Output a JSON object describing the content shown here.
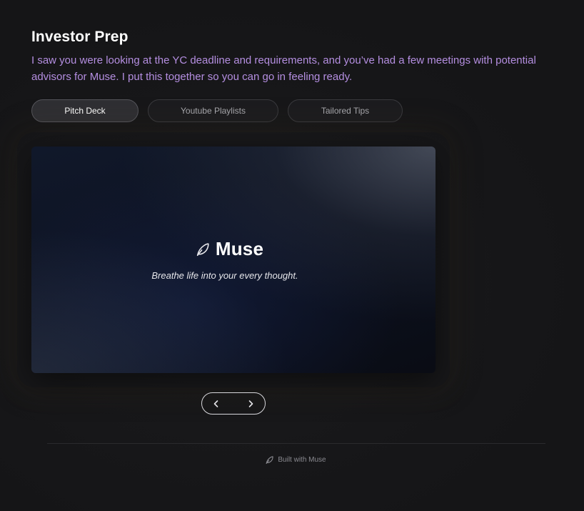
{
  "header": {
    "title": "Investor Prep",
    "subtitle": "I saw you were looking at the YC deadline and requirements, and you’ve had a few meetings with potential advisors for Muse. I put this together so you can go in feeling ready."
  },
  "tabs": [
    {
      "label": "Pitch Deck",
      "active": true
    },
    {
      "label": "Youtube Playlists",
      "active": false
    },
    {
      "label": "Tailored Tips",
      "active": false
    }
  ],
  "slide": {
    "brand_name": "Muse",
    "tagline": "Breathe life into your every thought.",
    "icon": "leaf-icon"
  },
  "pager": {
    "prev_icon": "chevron-left-icon",
    "next_icon": "chevron-right-icon"
  },
  "footer": {
    "text": "Built with Muse",
    "icon": "leaf-icon"
  },
  "colors": {
    "background": "#161618",
    "subtitle": "#b48ee0",
    "title": "#ffffff"
  }
}
